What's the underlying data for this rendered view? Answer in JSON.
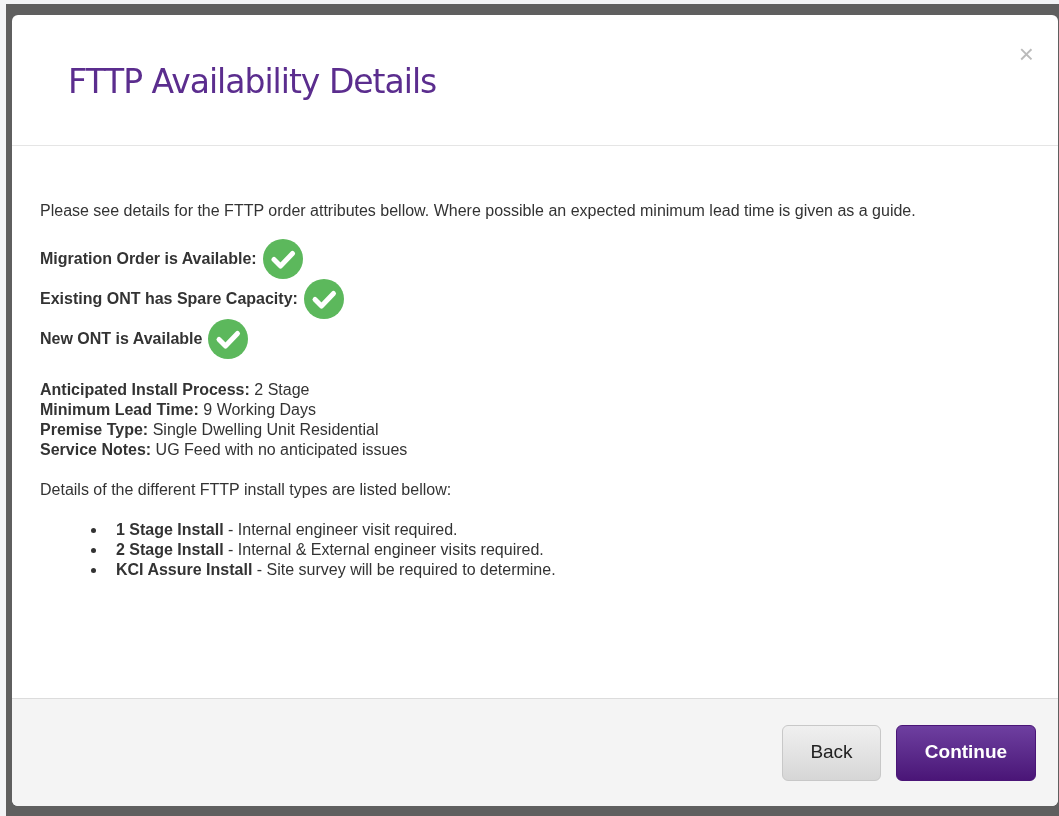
{
  "dialog": {
    "title": "FTTP Availability Details",
    "close": "×",
    "intro": "Please see details for the FTTP order attributes bellow. Where possible an expected minimum lead time is given as a guide.",
    "checks": [
      {
        "label": "Migration Order is Available:",
        "available": true
      },
      {
        "label": "Existing ONT has Spare Capacity:",
        "available": true
      },
      {
        "label": "New ONT is Available",
        "available": true
      }
    ],
    "details": [
      "**Anticipated Install Process:** 2 Stage",
      "**Minimum Lead Time:** 9 Working Days",
      "**Premise Type:** Single Dwelling Unit Residential",
      "**Service Notes:** UG Feed with no anticipated issues"
    ],
    "types_intro": "Details of the different FTTP install types are listed bellow:",
    "install_types": [
      "**1 Stage Install** - Internal engineer visit required.",
      "**2 Stage Install** - Internal & External engineer visits required.",
      "**KCI Assure Install** - Site survey will be required to determine."
    ],
    "buttons": [
      {
        "label": "Back",
        "kind": "secondary"
      },
      {
        "label": "Continue",
        "kind": "primary"
      }
    ]
  }
}
